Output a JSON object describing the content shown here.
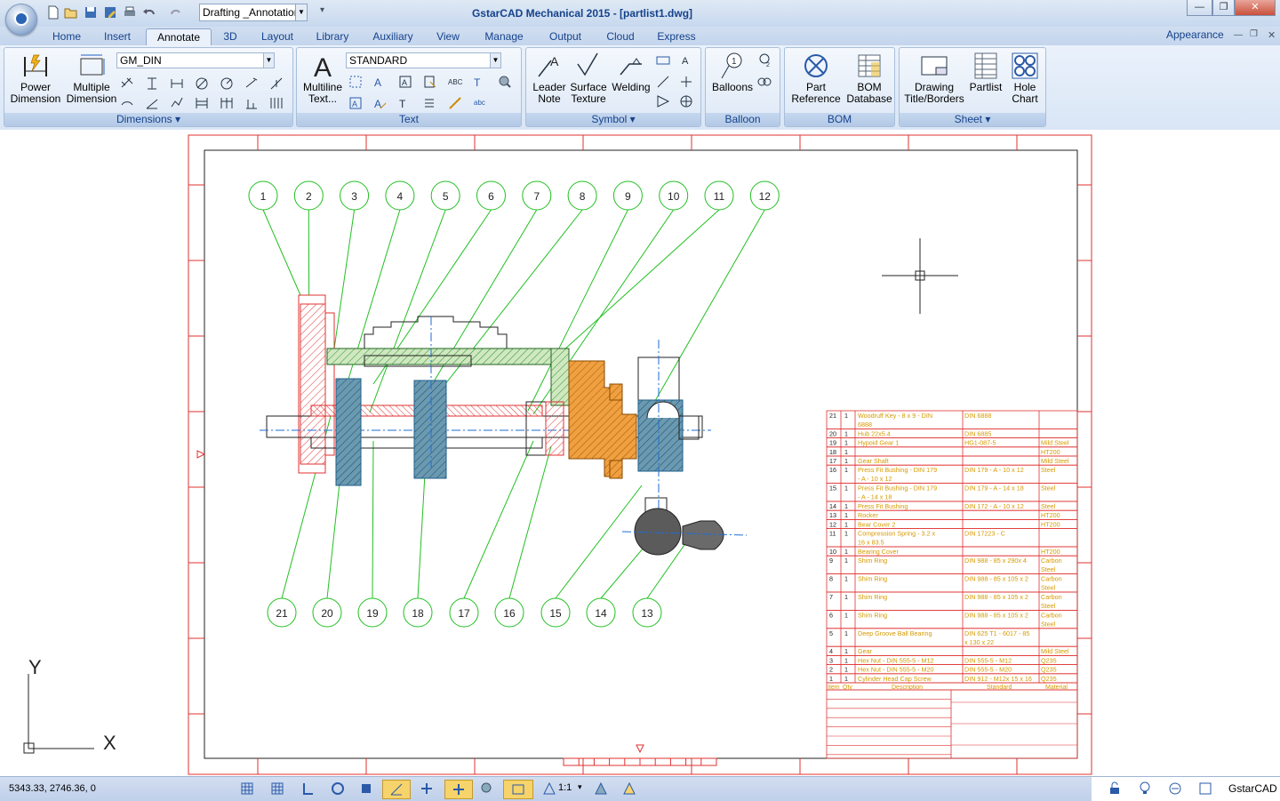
{
  "titlebar": {
    "workspace": "Drafting _Annotatior",
    "title": "GstarCAD Mechanical 2015 - [partlist1.dwg]",
    "minimize": "—",
    "restore": "❐",
    "close": "✕"
  },
  "tabs": [
    "Home",
    "Insert",
    "Annotate",
    "3D",
    "Layout",
    "Library",
    "Auxiliary",
    "View",
    "Manage",
    "Output",
    "Cloud",
    "Express"
  ],
  "appearance": "Appearance",
  "ribbon": {
    "dimensions": {
      "title": "Dimensions  ▾",
      "power_dimension": "Power\nDimension",
      "multiple_dimension": "Multiple\nDimension",
      "style": "GM_DIN"
    },
    "text": {
      "title": "Text",
      "multiline_text": "Multiline\nText...",
      "style": "STANDARD"
    },
    "symbol": {
      "title": "Symbol  ▾",
      "leader_note": "Leader\nNote",
      "surface_texture": "Surface\nTexture",
      "welding": "Welding"
    },
    "balloon": {
      "title": "Balloon",
      "balloons": "Balloons"
    },
    "bom": {
      "title": "BOM",
      "part_reference": "Part\nReference",
      "bom_database": "BOM\nDatabase"
    },
    "sheet": {
      "title": "Sheet  ▾",
      "drawing_title": "Drawing\nTitle/Borders",
      "partlist": "Partlist",
      "hole_chart": "Hole\nChart"
    }
  },
  "drawing": {
    "balloons_top": [
      "1",
      "2",
      "3",
      "4",
      "5",
      "6",
      "7",
      "8",
      "9",
      "10",
      "11",
      "12"
    ],
    "balloons_bottom": [
      "21",
      "20",
      "19",
      "18",
      "17",
      "16",
      "15",
      "14",
      "13"
    ],
    "partlist": [
      {
        "item": "21",
        "qty": "1",
        "desc": "Woodruff Key - 8 x 9 - DIN 6888",
        "std": "DIN 6888",
        "mat": ""
      },
      {
        "item": "20",
        "qty": "1",
        "desc": "Hub 22x5.4",
        "std": "DIN 6885",
        "mat": ""
      },
      {
        "item": "19",
        "qty": "1",
        "desc": "Hypoid Gear 1",
        "std": "HG1-087-5",
        "mat": "Mild Steel"
      },
      {
        "item": "18",
        "qty": "1",
        "desc": "",
        "std": "",
        "mat": "HT200"
      },
      {
        "item": "17",
        "qty": "1",
        "desc": "Gear Shaft",
        "std": "",
        "mat": "Mild Steel"
      },
      {
        "item": "16",
        "qty": "1",
        "desc": "Press Fit Bushing - DIN 179 - A - 10 x 12",
        "std": "DIN 179 - A - 10 x 12",
        "mat": "Steel"
      },
      {
        "item": "15",
        "qty": "1",
        "desc": "Press Fit Bushing - DIN 179 - A - 14 x 18",
        "std": "DIN 179 - A - 14 x 18",
        "mat": "Steel"
      },
      {
        "item": "14",
        "qty": "1",
        "desc": "Press Fit Bushing",
        "std": "DIN 172 - A - 10 x 12",
        "mat": "Steel"
      },
      {
        "item": "13",
        "qty": "1",
        "desc": "Rocker",
        "std": "",
        "mat": "HT200"
      },
      {
        "item": "12",
        "qty": "1",
        "desc": "Bear Cover 2",
        "std": "",
        "mat": "HT200"
      },
      {
        "item": "11",
        "qty": "1",
        "desc": "Compression Spring - 3.2 x 16 x 83.5",
        "std": "DIN 17223 - C",
        "mat": ""
      },
      {
        "item": "10",
        "qty": "1",
        "desc": "Bearing Cover",
        "std": "",
        "mat": "HT200"
      },
      {
        "item": "9",
        "qty": "1",
        "desc": "Shim Ring",
        "std": "DIN 988 - 85 x 290x 4",
        "mat": "Carbon Steel"
      },
      {
        "item": "8",
        "qty": "1",
        "desc": "Shim Ring",
        "std": "DIN 988 - 85 x 105 x 2",
        "mat": "Carbon Steel"
      },
      {
        "item": "7",
        "qty": "1",
        "desc": "Shim Ring",
        "std": "DIN 988 - 85 x 105 x 2",
        "mat": "Carbon Steel"
      },
      {
        "item": "6",
        "qty": "1",
        "desc": "Shim Ring",
        "std": "DIN 988 - 85 x 105 x 2",
        "mat": "Carbon Steel"
      },
      {
        "item": "5",
        "qty": "1",
        "desc": "Deep Groove Ball Bearing",
        "std": "DIN 625 T1 - 6017 - 85 x 130 x 22",
        "mat": ""
      },
      {
        "item": "4",
        "qty": "1",
        "desc": "Gear",
        "std": "",
        "mat": "Mild Steel"
      },
      {
        "item": "3",
        "qty": "1",
        "desc": "Hex Nut - DIN 555-5 - M12",
        "std": "DIN 555-5 - M12",
        "mat": "Q235"
      },
      {
        "item": "2",
        "qty": "1",
        "desc": "Hex Nut - DIN 555-5 - M20",
        "std": "DIN 555-5 - M20",
        "mat": "Q235"
      },
      {
        "item": "1",
        "qty": "1",
        "desc": "Cylinder Head Cap Screw",
        "std": "DIN 912 - M12x 15 x 16",
        "mat": "Q235"
      }
    ],
    "partlist_header": {
      "item": "Item",
      "qty": "Qty",
      "desc": "Description",
      "std": "Standard",
      "mat": "Material"
    },
    "ucs_x": "X",
    "ucs_y": "Y"
  },
  "status": {
    "coords": "5343.33, 2746.36, 0",
    "scale": "1:1",
    "app": "GstarCAD"
  }
}
